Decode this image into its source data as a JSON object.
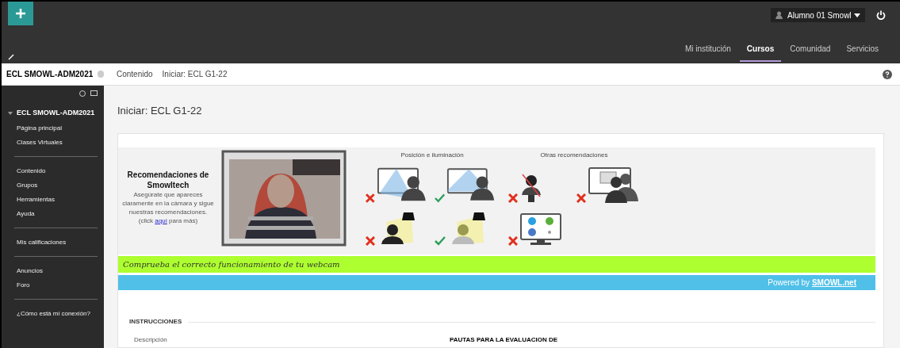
{
  "header": {
    "user": "Alumno 01 Smowl",
    "nav": [
      {
        "label": "Mi institución",
        "selected": false
      },
      {
        "label": "Cursos",
        "selected": true
      },
      {
        "label": "Comunidad",
        "selected": false
      },
      {
        "label": "Servicios",
        "selected": false
      }
    ]
  },
  "breadcrumb": {
    "course": "ECL SMOWL-ADM2021",
    "crumbs": [
      "Contenido",
      "Iniciar: ECL G1-22"
    ]
  },
  "sidebar": {
    "course_title": "ECL SMOWL-ADM2021",
    "groups": [
      [
        "Página principal",
        "Clases Virtuales"
      ],
      [
        "Contenido",
        "Grupos",
        "Herramientas",
        "Ayuda"
      ],
      [
        "Mis calificaciones"
      ],
      [
        "Anuncios",
        "Foro"
      ],
      [
        "¿Cómo está mi conexión?"
      ]
    ]
  },
  "page_title": "Iniciar: ECL G1-22",
  "smowl": {
    "title": "Recomendaciones de Smowltech",
    "description": "Asegúrate que apareces claramente en la cámara y sigue nuestras recomendaciones.",
    "more_prefix": "(click ",
    "more_link": "aquí",
    "more_suffix": " para más)",
    "sections": [
      {
        "title": "Posición e iluminación",
        "items": [
          {
            "kind": "monitor-person",
            "approved": false
          },
          {
            "kind": "monitor-person",
            "approved": true
          },
          {
            "kind": "lamp-person",
            "approved": false
          },
          {
            "kind": "lamp-person",
            "approved": true
          }
        ]
      },
      {
        "title": "Otras recomendaciones",
        "items": [
          {
            "kind": "disguise",
            "approved": false
          },
          {
            "kind": "monitor-group",
            "approved": false
          },
          {
            "kind": "monitor-apps",
            "approved": false
          }
        ]
      }
    ],
    "check_banner": "Comprueba el correcto funcionamiento de tu webcam",
    "powered_prefix": "Powered by ",
    "powered_link": "SMOWL.net"
  },
  "instructions": {
    "heading": "INSTRUCCIONES",
    "label": "Descripción",
    "value": "PAUTAS PARA LA EVALUACION DE"
  }
}
